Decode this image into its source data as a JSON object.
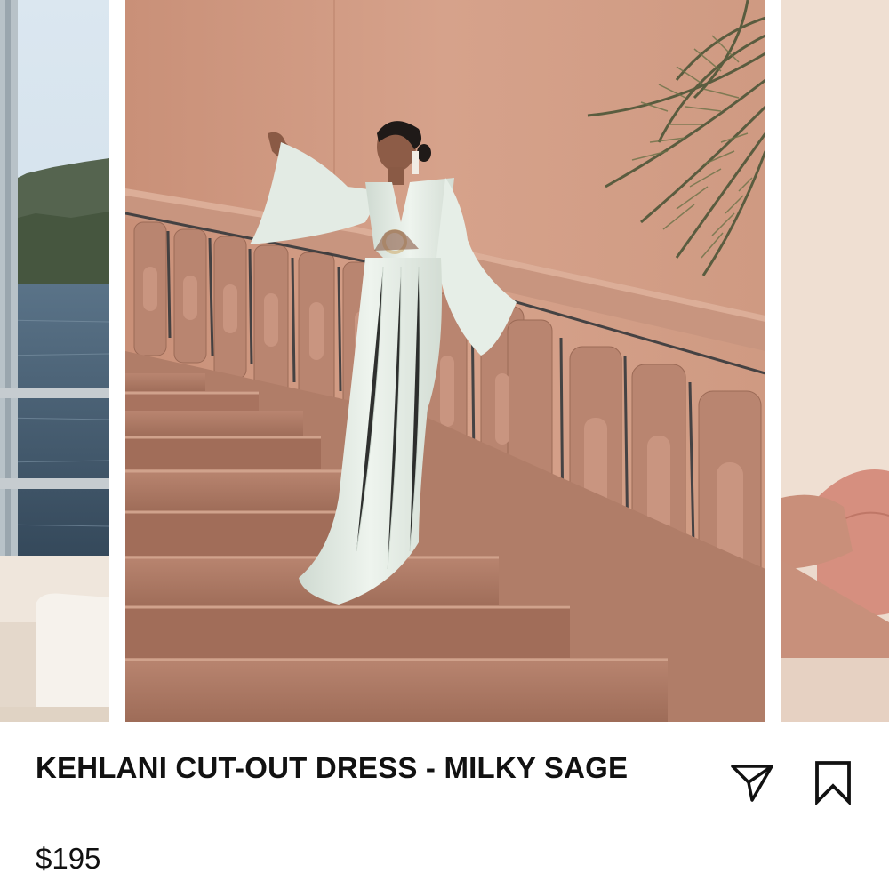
{
  "product": {
    "title": "KEHLANI CUT-OUT DRESS - MILKY SAGE",
    "price": "$195"
  },
  "carousel": {
    "current_index": 1,
    "slides": [
      {
        "depicts": "yacht-deck-sea-view"
      },
      {
        "depicts": "woman-white-dress-on-stone-staircase"
      },
      {
        "depicts": "pink-sleeve-arm"
      }
    ]
  },
  "actions": {
    "share_icon": "paper-plane-icon",
    "save_icon": "bookmark-icon"
  },
  "colors": {
    "background": "#ffffff",
    "text": "#111111",
    "wall": "#d49c84",
    "dress": "#e6eee6"
  }
}
